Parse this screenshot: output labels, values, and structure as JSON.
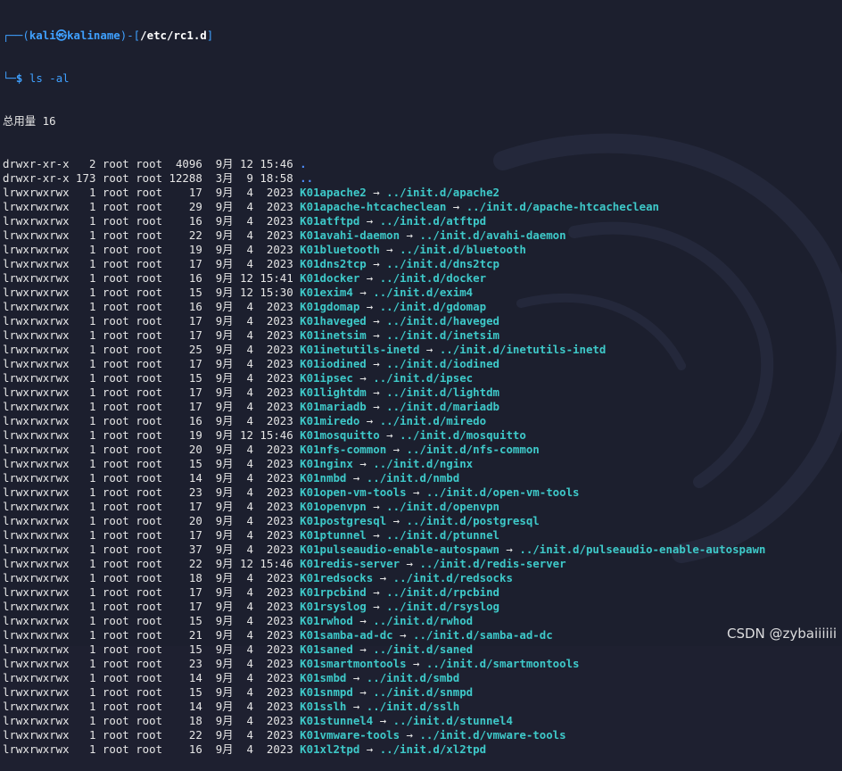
{
  "prompt": {
    "frame_top_left": "┌──(",
    "user_host": "kali㉿kaliname",
    "frame_mid": ")-[",
    "path": "/etc/rc1.d",
    "frame_end": "]",
    "frame_bottom": "└─",
    "dollar": "$",
    "command": "ls -al"
  },
  "total_line": "总用量 16",
  "entries": [
    {
      "perm": "drwxr-xr-x",
      "links": "  2",
      "owner": "root",
      "group": "root",
      "size": " 4096",
      "month": "9月",
      "day": "12",
      "time": "15:46",
      "name": ".",
      "kind": "dir",
      "target": ""
    },
    {
      "perm": "drwxr-xr-x",
      "links": "173",
      "owner": "root",
      "group": "root",
      "size": "12288",
      "month": "3月",
      "day": " 9",
      "time": "18:58",
      "name": "..",
      "kind": "dir",
      "target": ""
    },
    {
      "perm": "lrwxrwxrwx",
      "links": "  1",
      "owner": "root",
      "group": "root",
      "size": "   17",
      "month": "9月",
      "day": " 4",
      "time": " 2023",
      "name": "K01apache2",
      "kind": "link",
      "target": "../init.d/apache2"
    },
    {
      "perm": "lrwxrwxrwx",
      "links": "  1",
      "owner": "root",
      "group": "root",
      "size": "   29",
      "month": "9月",
      "day": " 4",
      "time": " 2023",
      "name": "K01apache-htcacheclean",
      "kind": "link",
      "target": "../init.d/apache-htcacheclean"
    },
    {
      "perm": "lrwxrwxrwx",
      "links": "  1",
      "owner": "root",
      "group": "root",
      "size": "   16",
      "month": "9月",
      "day": " 4",
      "time": " 2023",
      "name": "K01atftpd",
      "kind": "link",
      "target": "../init.d/atftpd"
    },
    {
      "perm": "lrwxrwxrwx",
      "links": "  1",
      "owner": "root",
      "group": "root",
      "size": "   22",
      "month": "9月",
      "day": " 4",
      "time": " 2023",
      "name": "K01avahi-daemon",
      "kind": "link",
      "target": "../init.d/avahi-daemon"
    },
    {
      "perm": "lrwxrwxrwx",
      "links": "  1",
      "owner": "root",
      "group": "root",
      "size": "   19",
      "month": "9月",
      "day": " 4",
      "time": " 2023",
      "name": "K01bluetooth",
      "kind": "link",
      "target": "../init.d/bluetooth"
    },
    {
      "perm": "lrwxrwxrwx",
      "links": "  1",
      "owner": "root",
      "group": "root",
      "size": "   17",
      "month": "9月",
      "day": " 4",
      "time": " 2023",
      "name": "K01dns2tcp",
      "kind": "link",
      "target": "../init.d/dns2tcp"
    },
    {
      "perm": "lrwxrwxrwx",
      "links": "  1",
      "owner": "root",
      "group": "root",
      "size": "   16",
      "month": "9月",
      "day": "12",
      "time": "15:41",
      "name": "K01docker",
      "kind": "link",
      "target": "../init.d/docker"
    },
    {
      "perm": "lrwxrwxrwx",
      "links": "  1",
      "owner": "root",
      "group": "root",
      "size": "   15",
      "month": "9月",
      "day": "12",
      "time": "15:30",
      "name": "K01exim4",
      "kind": "link",
      "target": "../init.d/exim4"
    },
    {
      "perm": "lrwxrwxrwx",
      "links": "  1",
      "owner": "root",
      "group": "root",
      "size": "   16",
      "month": "9月",
      "day": " 4",
      "time": " 2023",
      "name": "K01gdomap",
      "kind": "link",
      "target": "../init.d/gdomap"
    },
    {
      "perm": "lrwxrwxrwx",
      "links": "  1",
      "owner": "root",
      "group": "root",
      "size": "   17",
      "month": "9月",
      "day": " 4",
      "time": " 2023",
      "name": "K01haveged",
      "kind": "link",
      "target": "../init.d/haveged"
    },
    {
      "perm": "lrwxrwxrwx",
      "links": "  1",
      "owner": "root",
      "group": "root",
      "size": "   17",
      "month": "9月",
      "day": " 4",
      "time": " 2023",
      "name": "K01inetsim",
      "kind": "link",
      "target": "../init.d/inetsim"
    },
    {
      "perm": "lrwxrwxrwx",
      "links": "  1",
      "owner": "root",
      "group": "root",
      "size": "   25",
      "month": "9月",
      "day": " 4",
      "time": " 2023",
      "name": "K01inetutils-inetd",
      "kind": "link",
      "target": "../init.d/inetutils-inetd"
    },
    {
      "perm": "lrwxrwxrwx",
      "links": "  1",
      "owner": "root",
      "group": "root",
      "size": "   17",
      "month": "9月",
      "day": " 4",
      "time": " 2023",
      "name": "K01iodined",
      "kind": "link",
      "target": "../init.d/iodined"
    },
    {
      "perm": "lrwxrwxrwx",
      "links": "  1",
      "owner": "root",
      "group": "root",
      "size": "   15",
      "month": "9月",
      "day": " 4",
      "time": " 2023",
      "name": "K01ipsec",
      "kind": "link",
      "target": "../init.d/ipsec"
    },
    {
      "perm": "lrwxrwxrwx",
      "links": "  1",
      "owner": "root",
      "group": "root",
      "size": "   17",
      "month": "9月",
      "day": " 4",
      "time": " 2023",
      "name": "K01lightdm",
      "kind": "link",
      "target": "../init.d/lightdm"
    },
    {
      "perm": "lrwxrwxrwx",
      "links": "  1",
      "owner": "root",
      "group": "root",
      "size": "   17",
      "month": "9月",
      "day": " 4",
      "time": " 2023",
      "name": "K01mariadb",
      "kind": "link",
      "target": "../init.d/mariadb"
    },
    {
      "perm": "lrwxrwxrwx",
      "links": "  1",
      "owner": "root",
      "group": "root",
      "size": "   16",
      "month": "9月",
      "day": " 4",
      "time": " 2023",
      "name": "K01miredo",
      "kind": "link",
      "target": "../init.d/miredo"
    },
    {
      "perm": "lrwxrwxrwx",
      "links": "  1",
      "owner": "root",
      "group": "root",
      "size": "   19",
      "month": "9月",
      "day": "12",
      "time": "15:46",
      "name": "K01mosquitto",
      "kind": "link",
      "target": "../init.d/mosquitto"
    },
    {
      "perm": "lrwxrwxrwx",
      "links": "  1",
      "owner": "root",
      "group": "root",
      "size": "   20",
      "month": "9月",
      "day": " 4",
      "time": " 2023",
      "name": "K01nfs-common",
      "kind": "link",
      "target": "../init.d/nfs-common"
    },
    {
      "perm": "lrwxrwxrwx",
      "links": "  1",
      "owner": "root",
      "group": "root",
      "size": "   15",
      "month": "9月",
      "day": " 4",
      "time": " 2023",
      "name": "K01nginx",
      "kind": "link",
      "target": "../init.d/nginx"
    },
    {
      "perm": "lrwxrwxrwx",
      "links": "  1",
      "owner": "root",
      "group": "root",
      "size": "   14",
      "month": "9月",
      "day": " 4",
      "time": " 2023",
      "name": "K01nmbd",
      "kind": "link",
      "target": "../init.d/nmbd"
    },
    {
      "perm": "lrwxrwxrwx",
      "links": "  1",
      "owner": "root",
      "group": "root",
      "size": "   23",
      "month": "9月",
      "day": " 4",
      "time": " 2023",
      "name": "K01open-vm-tools",
      "kind": "link",
      "target": "../init.d/open-vm-tools"
    },
    {
      "perm": "lrwxrwxrwx",
      "links": "  1",
      "owner": "root",
      "group": "root",
      "size": "   17",
      "month": "9月",
      "day": " 4",
      "time": " 2023",
      "name": "K01openvpn",
      "kind": "link",
      "target": "../init.d/openvpn"
    },
    {
      "perm": "lrwxrwxrwx",
      "links": "  1",
      "owner": "root",
      "group": "root",
      "size": "   20",
      "month": "9月",
      "day": " 4",
      "time": " 2023",
      "name": "K01postgresql",
      "kind": "link",
      "target": "../init.d/postgresql"
    },
    {
      "perm": "lrwxrwxrwx",
      "links": "  1",
      "owner": "root",
      "group": "root",
      "size": "   17",
      "month": "9月",
      "day": " 4",
      "time": " 2023",
      "name": "K01ptunnel",
      "kind": "link",
      "target": "../init.d/ptunnel"
    },
    {
      "perm": "lrwxrwxrwx",
      "links": "  1",
      "owner": "root",
      "group": "root",
      "size": "   37",
      "month": "9月",
      "day": " 4",
      "time": " 2023",
      "name": "K01pulseaudio-enable-autospawn",
      "kind": "link",
      "target": "../init.d/pulseaudio-enable-autospawn"
    },
    {
      "perm": "lrwxrwxrwx",
      "links": "  1",
      "owner": "root",
      "group": "root",
      "size": "   22",
      "month": "9月",
      "day": "12",
      "time": "15:46",
      "name": "K01redis-server",
      "kind": "link",
      "target": "../init.d/redis-server"
    },
    {
      "perm": "lrwxrwxrwx",
      "links": "  1",
      "owner": "root",
      "group": "root",
      "size": "   18",
      "month": "9月",
      "day": " 4",
      "time": " 2023",
      "name": "K01redsocks",
      "kind": "link",
      "target": "../init.d/redsocks"
    },
    {
      "perm": "lrwxrwxrwx",
      "links": "  1",
      "owner": "root",
      "group": "root",
      "size": "   17",
      "month": "9月",
      "day": " 4",
      "time": " 2023",
      "name": "K01rpcbind",
      "kind": "link",
      "target": "../init.d/rpcbind"
    },
    {
      "perm": "lrwxrwxrwx",
      "links": "  1",
      "owner": "root",
      "group": "root",
      "size": "   17",
      "month": "9月",
      "day": " 4",
      "time": " 2023",
      "name": "K01rsyslog",
      "kind": "link",
      "target": "../init.d/rsyslog"
    },
    {
      "perm": "lrwxrwxrwx",
      "links": "  1",
      "owner": "root",
      "group": "root",
      "size": "   15",
      "month": "9月",
      "day": " 4",
      "time": " 2023",
      "name": "K01rwhod",
      "kind": "link",
      "target": "../init.d/rwhod"
    },
    {
      "perm": "lrwxrwxrwx",
      "links": "  1",
      "owner": "root",
      "group": "root",
      "size": "   21",
      "month": "9月",
      "day": " 4",
      "time": " 2023",
      "name": "K01samba-ad-dc",
      "kind": "link",
      "target": "../init.d/samba-ad-dc"
    },
    {
      "perm": "lrwxrwxrwx",
      "links": "  1",
      "owner": "root",
      "group": "root",
      "size": "   15",
      "month": "9月",
      "day": " 4",
      "time": " 2023",
      "name": "K01saned",
      "kind": "link",
      "target": "../init.d/saned"
    },
    {
      "perm": "lrwxrwxrwx",
      "links": "  1",
      "owner": "root",
      "group": "root",
      "size": "   23",
      "month": "9月",
      "day": " 4",
      "time": " 2023",
      "name": "K01smartmontools",
      "kind": "link",
      "target": "../init.d/smartmontools"
    },
    {
      "perm": "lrwxrwxrwx",
      "links": "  1",
      "owner": "root",
      "group": "root",
      "size": "   14",
      "month": "9月",
      "day": " 4",
      "time": " 2023",
      "name": "K01smbd",
      "kind": "link",
      "target": "../init.d/smbd"
    },
    {
      "perm": "lrwxrwxrwx",
      "links": "  1",
      "owner": "root",
      "group": "root",
      "size": "   15",
      "month": "9月",
      "day": " 4",
      "time": " 2023",
      "name": "K01snmpd",
      "kind": "link",
      "target": "../init.d/snmpd"
    },
    {
      "perm": "lrwxrwxrwx",
      "links": "  1",
      "owner": "root",
      "group": "root",
      "size": "   14",
      "month": "9月",
      "day": " 4",
      "time": " 2023",
      "name": "K01sslh",
      "kind": "link",
      "target": "../init.d/sslh"
    },
    {
      "perm": "lrwxrwxrwx",
      "links": "  1",
      "owner": "root",
      "group": "root",
      "size": "   18",
      "month": "9月",
      "day": " 4",
      "time": " 2023",
      "name": "K01stunnel4",
      "kind": "link",
      "target": "../init.d/stunnel4"
    },
    {
      "perm": "lrwxrwxrwx",
      "links": "  1",
      "owner": "root",
      "group": "root",
      "size": "   22",
      "month": "9月",
      "day": " 4",
      "time": " 2023",
      "name": "K01vmware-tools",
      "kind": "link",
      "target": "../init.d/vmware-tools"
    },
    {
      "perm": "lrwxrwxrwx",
      "links": "  1",
      "owner": "root",
      "group": "root",
      "size": "   16",
      "month": "9月",
      "day": " 4",
      "time": " 2023",
      "name": "K01xl2tpd",
      "kind": "link",
      "target": "../init.d/xl2tpd"
    }
  ],
  "arrow_glyph": "→",
  "watermark": "CSDN @zybaiiiiii",
  "colors": {
    "background": "#1c1f2e",
    "prompt_blue": "#3fa0ff",
    "link_cyan": "#3ec9c9",
    "dir_blue": "#4f8fff",
    "text": "#e6e6e6"
  },
  "icons": {
    "background_logo": "kali-dragon-icon"
  }
}
